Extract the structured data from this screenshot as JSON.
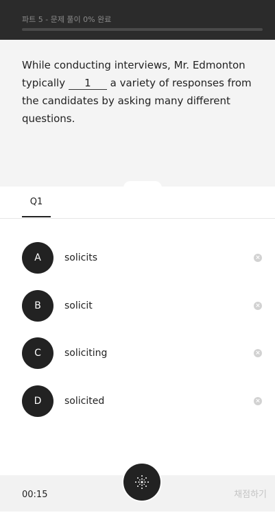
{
  "header": {
    "title": "파트 5 - 문제 풀이 0% 완료",
    "progress_percent": 0
  },
  "question": {
    "text_before": "While conducting interviews, Mr. Edmonton typically ",
    "blank_number": "1",
    "text_after": " a variety of responses from the candidates by asking many different questions."
  },
  "tabs": [
    {
      "label": "Q1",
      "active": true
    }
  ],
  "options": [
    {
      "letter": "A",
      "text": "solicits"
    },
    {
      "letter": "B",
      "text": "solicit"
    },
    {
      "letter": "C",
      "text": "soliciting"
    },
    {
      "letter": "D",
      "text": "solicited"
    }
  ],
  "footer": {
    "timer": "00:15",
    "grade_label": "채점하기"
  },
  "icons": {
    "center_button": "sparkle-dots-icon",
    "option_dismiss": "close-circle-icon"
  }
}
